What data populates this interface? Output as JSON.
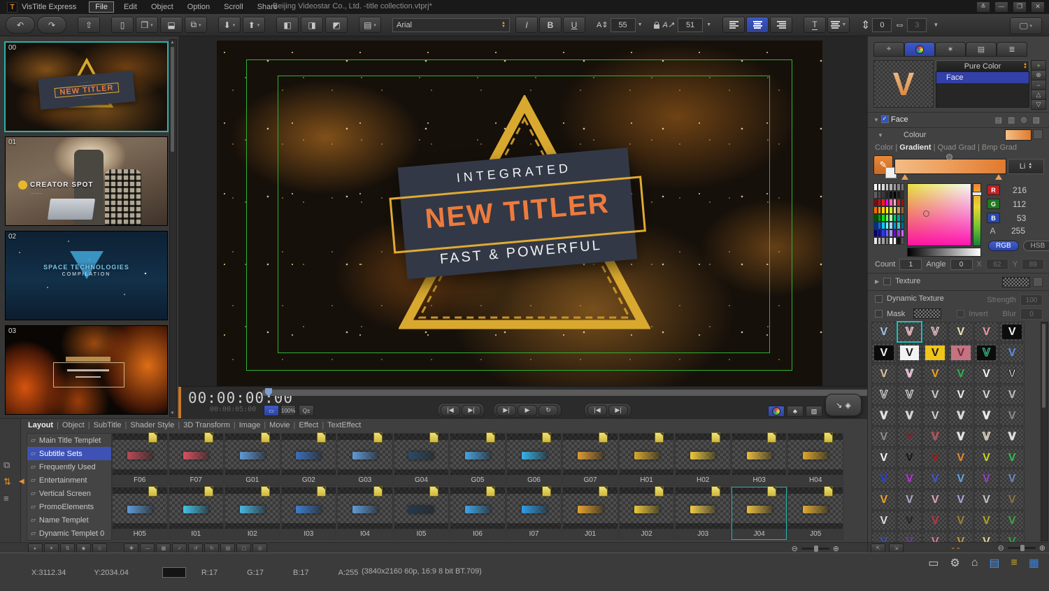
{
  "window": {
    "app_name": "VisTitle Express",
    "logo_letter": "T",
    "menus": [
      "File",
      "Edit",
      "Object",
      "Option",
      "Scroll",
      "Share"
    ],
    "active_menu": "File",
    "title": "Beijing Videostar Co., Ltd. -title collection.vtprj*",
    "window_controls": [
      {
        "name": "collapse-icon",
        "g": "≚"
      },
      {
        "name": "minimize-icon",
        "g": "—"
      },
      {
        "name": "restore-icon",
        "g": "❐"
      },
      {
        "name": "close-icon",
        "g": "✕"
      }
    ]
  },
  "toolbar": {
    "font_family": "Arial",
    "font_size": "55",
    "kerning": "51",
    "line_spacing": "0",
    "char_spacing": "3",
    "italic": "I",
    "bold": "B",
    "underline": "U",
    "groups": [
      {
        "cls": "pill",
        "items": [
          {
            "n": "undo-icon",
            "g": "↶"
          },
          {
            "n": "redo-icon",
            "g": "↷"
          }
        ]
      },
      {
        "items": [
          {
            "n": "publish-icon",
            "g": "⇧"
          }
        ]
      },
      {
        "items": [
          {
            "n": "new-document-icon",
            "g": "▯"
          },
          {
            "n": "open-project-icon",
            "g": "❒",
            "dd": true
          },
          {
            "n": "save-icon",
            "g": "⬓"
          },
          {
            "n": "save-all-icon",
            "g": "⧉",
            "dd": true
          }
        ]
      },
      {
        "items": [
          {
            "n": "import-icon",
            "g": "⬇",
            "dd": true
          },
          {
            "n": "export-icon",
            "g": "⬆",
            "dd": true
          }
        ]
      },
      {
        "items": [
          {
            "n": "clapper-new-icon",
            "g": "◧"
          },
          {
            "n": "clapper-open-icon",
            "g": "◨"
          },
          {
            "n": "clapper-save-icon",
            "g": "◩"
          }
        ]
      },
      {
        "items": [
          {
            "n": "script-edit-icon",
            "g": "▤",
            "dd": true
          }
        ]
      }
    ]
  },
  "slides": {
    "items": [
      {
        "id": "00",
        "variant": "titler",
        "selected": true
      },
      {
        "id": "01",
        "variant": "creator",
        "selected": false
      },
      {
        "id": "02",
        "variant": "space",
        "selected": false
      },
      {
        "id": "03",
        "variant": "fire",
        "selected": false
      }
    ],
    "titler_line2": "NEW TITLER",
    "creator_label": "CREATOR SPOT",
    "space_line1": "SPACE TECHNOLOGIES",
    "space_line2": "COMPILATION"
  },
  "preview": {
    "line1": "INTEGRATED",
    "line2": "NEW TITLER",
    "line3": "FAST & POWERFUL",
    "safe_color": "#2db32d",
    "triangle_color": "#d9a92f",
    "banner_color": "#323846",
    "accent_text": "#ed7b3d"
  },
  "timeline": {
    "timecode": "00:00:00:00",
    "duration": "00:00:05:00",
    "zoom_level": "100%",
    "monitor_icon": "▭",
    "magnify_icon": "Q±",
    "transport": [
      {
        "grp": [
          {
            "n": "jump-start-button",
            "g": "|◀"
          },
          {
            "n": "jump-end-button",
            "g": "▶|"
          }
        ]
      },
      {
        "grp": [
          {
            "n": "play-from-start-button",
            "g": "▶|"
          },
          {
            "n": "play-button",
            "g": "▶"
          },
          {
            "n": "loop-button",
            "g": "↻"
          }
        ]
      },
      {
        "grp": [
          {
            "n": "prev-frame-button",
            "g": "|◀"
          },
          {
            "n": "next-frame-button",
            "g": "▶|"
          }
        ]
      }
    ],
    "right_buttons": [
      {
        "n": "color-mode-button",
        "kind": "wheel",
        "active": true
      },
      {
        "n": "clover-button",
        "g": "♣"
      },
      {
        "n": "image-mode-button",
        "g": "▨"
      }
    ],
    "pill_icons": [
      {
        "n": "transform-icon",
        "g": "↘"
      },
      {
        "n": "keyframe-icon",
        "g": "◈"
      }
    ]
  },
  "right_panel": {
    "tabs": [
      {
        "n": "select-tool-tab",
        "g": "⌖",
        "active": false
      },
      {
        "n": "color-style-tab",
        "g": "wheel",
        "active": true
      },
      {
        "n": "effect-wand-tab",
        "g": "✶",
        "active": false
      },
      {
        "n": "template-doc-tab",
        "g": "▤",
        "active": false
      },
      {
        "n": "layer-list-tab",
        "g": "≣",
        "active": false
      }
    ],
    "side_buttons": [
      {
        "n": "add-style-button",
        "g": "+",
        "c": "#84c96c"
      },
      {
        "n": "add-multi-button",
        "g": "⊕",
        "c": "#bbb"
      },
      {
        "n": "remove-style-button",
        "g": "−",
        "c": "#bbb"
      },
      {
        "n": "move-up-button",
        "g": "△",
        "c": "#bbb"
      },
      {
        "n": "move-down-button",
        "g": "▽",
        "c": "#bbb"
      }
    ],
    "preview_letter": "V",
    "style_mode": "Pure Color",
    "layer_item": "Face",
    "face_label": "Face",
    "face_icons": [
      "▤",
      "▥",
      "⊜",
      "▧"
    ],
    "colour_label": "Colour",
    "grad_tabs": [
      "Color",
      "Gradient",
      "Quad Grad",
      "Bmp Grad"
    ],
    "active_grad_tab": "Gradient",
    "li_label": "Li",
    "eyedropper_icon": "✎",
    "rgb": {
      "r_label": "R",
      "r": "216",
      "g_label": "G",
      "g": "112",
      "b_label": "B",
      "b": "53",
      "a_label": "A",
      "a": "255"
    },
    "mode_rgb": "RGB",
    "mode_hsb": "HSB",
    "count_label": "Count",
    "count": "1",
    "angle_label": "Angle",
    "angle": "0",
    "x_label": "X",
    "x": "62",
    "y_label": "Y",
    "y": "89",
    "texture_label": "Texture",
    "dynamic_texture_label": "Dynamic Texture",
    "strength_label": "Strength",
    "strength": "100",
    "mask_label": "Mask",
    "invert_label": "Invert",
    "blur_label": "Blur",
    "blur": "0",
    "palette": [
      "#ffffff",
      "#ececec",
      "#d8d8d8",
      "#c4c4c4",
      "#b0b0b0",
      "#9c9c9c",
      "#888888",
      "#747474",
      "#606060",
      "#4c4c4c",
      "#383838",
      "#242424",
      "#101010",
      "#000000",
      "#1c1c1c",
      "#303030",
      "#7a0c0c",
      "#c01010",
      "#ff1a1a",
      "#ff00ff",
      "#ff66b0",
      "#ffb6c1",
      "#d02020",
      "#901414",
      "#ff6600",
      "#ff9900",
      "#ffcc00",
      "#ffff00",
      "#ccee22",
      "#ffd699",
      "#cc9955",
      "#996633",
      "#005500",
      "#00a000",
      "#00ee00",
      "#66ff66",
      "#aaffaa",
      "#00cc66",
      "#00a0a0",
      "#006666",
      "#003090",
      "#0066ff",
      "#00ccff",
      "#66ffff",
      "#a8d4ff",
      "#0099cc",
      "#33cccc",
      "#006699",
      "#000066",
      "#0000cc",
      "#3333ff",
      "#6666ff",
      "#9999ff",
      "#7700cc",
      "#9933ff",
      "#cc66ff",
      "#e8e8e8",
      "#c0c0c0",
      "#a0a0a0",
      "#808080",
      "#f0f0f0",
      "#ffffff",
      "#111111",
      "#555555"
    ]
  },
  "presets": {
    "letter": "V",
    "selected_index": 1,
    "items": [
      {
        "c": "#9ec3e2"
      },
      {
        "c": "#d6404e",
        "o": "#f2f2f2"
      },
      {
        "c": "#8c2633",
        "o": "#f2f2f2"
      },
      {
        "c": "#ece6b4"
      },
      {
        "c": "#eb9aa2"
      },
      {
        "c": "#f5f5f5",
        "bg": "#0d0d0d"
      },
      {
        "c": "#f5f5f5",
        "bg": "#0a0a0a"
      },
      {
        "c": "#141414",
        "bg": "#f2f2f2"
      },
      {
        "c": "#1a1a1a",
        "bg": "#f0c419"
      },
      {
        "c": "#71293a",
        "bg": "#c47480"
      },
      {
        "c": "#101010",
        "o": "#3ddc97",
        "bg": "#0c0c0c"
      },
      {
        "c": "#5b8fe8"
      },
      {
        "c": "#dcc3a1"
      },
      {
        "c": "#e26ca8",
        "o": "#f5f5f5"
      },
      {
        "c": "#f0a21e"
      },
      {
        "c": "#2eb34a"
      },
      {
        "c": "#f2f2f2"
      },
      {
        "c": "#fdfdfd",
        "o": "#1a1a1a"
      },
      {
        "c": "#161616",
        "o": "#f5f5f5"
      },
      {
        "c": "#101010",
        "o": "#ffffff"
      },
      {
        "c": "#c9c9c9"
      },
      {
        "c": "#ededed"
      },
      {
        "c": "#d4d4d4"
      },
      {
        "c": "#bdbdbd"
      },
      {
        "c": "transparent",
        "o": "#e8e8e8"
      },
      {
        "c": "transparent",
        "o": "#dddddd"
      },
      {
        "c": "#cfcfcf"
      },
      {
        "c": "transparent",
        "o": "#e0e0e0"
      },
      {
        "c": "transparent",
        "o": "#f0f0f0"
      },
      {
        "c": "#8a8a8a"
      },
      {
        "c": "#8f8f8f"
      },
      {
        "c": "#7e2230"
      },
      {
        "c": "#3a6fd8",
        "o": "#d84a2e"
      },
      {
        "c": "transparent",
        "o": "#ececec"
      },
      {
        "c": "#a5834a",
        "o": "#f0f0f0"
      },
      {
        "c": "transparent",
        "o": "#e6e6e6"
      },
      {
        "c": "#f5f5f5"
      },
      {
        "c": "#161616"
      },
      {
        "c": "#9e1b1b"
      },
      {
        "c": "#e8892b"
      },
      {
        "c": "#cdd41c"
      },
      {
        "c": "#2ec04e"
      },
      {
        "c": "#2440dd"
      },
      {
        "c": "#bd2ee0"
      },
      {
        "c": "#3f54d6"
      },
      {
        "c": "#5ea6ec"
      },
      {
        "c": "#9340c4"
      },
      {
        "c": "#6a86c8"
      },
      {
        "c": "#eda224"
      },
      {
        "c": "#b3a6cc"
      },
      {
        "c": "#dca6b4"
      },
      {
        "c": "#b1a2dc"
      },
      {
        "c": "#c3c3cd"
      },
      {
        "c": "#8d7140"
      },
      {
        "c": "#dcdce4"
      },
      {
        "c": "#242424"
      },
      {
        "c": "#c23243"
      },
      {
        "c": "#9c8030"
      },
      {
        "c": "#b2a41e"
      },
      {
        "c": "#3da445"
      },
      {
        "c": "#3353c6"
      },
      {
        "c": "#8430b4"
      },
      {
        "c": "#e274a6"
      },
      {
        "c": "#cf9340"
      },
      {
        "c": "#e2d494"
      },
      {
        "c": "#31a437"
      }
    ]
  },
  "bottom": {
    "tabs": [
      "Layout",
      "Object",
      "SubTitle",
      "Shader Style",
      "3D Transform",
      "Image",
      "Movie",
      "Effect",
      "TextEffect"
    ],
    "active_tab": "Layout",
    "categories": [
      "Main Title Templet",
      "Subtitle Sets",
      "Frequently Used",
      "Entertainment",
      "Vertical Screen",
      "PromoElements",
      "Name Templet",
      "Dynamic Templet 0"
    ],
    "selected_category": "Subtitle Sets",
    "row1": [
      {
        "label": "F06",
        "color": "#b84a56"
      },
      {
        "label": "F07",
        "color": "#d85060"
      },
      {
        "label": "G01",
        "color": "#5f9bd8"
      },
      {
        "label": "G02",
        "color": "#3d6fb8"
      },
      {
        "label": "G03",
        "color": "#5f9bd8"
      },
      {
        "label": "G04",
        "color": "#2c4a66"
      },
      {
        "label": "G05",
        "color": "#49a2e0"
      },
      {
        "label": "G06",
        "color": "#37b2e8"
      },
      {
        "label": "G07",
        "color": "#e09a34"
      },
      {
        "label": "H01",
        "color": "#d8a830"
      },
      {
        "label": "H02",
        "color": "#ecc83e"
      },
      {
        "label": "H03",
        "color": "#e8bc40"
      },
      {
        "label": "H04",
        "color": "#dca62c"
      }
    ],
    "row2": [
      {
        "label": "H05",
        "color": "#5f9bd8"
      },
      {
        "label": "I01",
        "color": "#45c2e8"
      },
      {
        "label": "I02",
        "color": "#49b6e0"
      },
      {
        "label": "I03",
        "color": "#3d7fd0"
      },
      {
        "label": "I04",
        "color": "#5f9bd8"
      },
      {
        "label": "I05",
        "color": "#24384c"
      },
      {
        "label": "I06",
        "color": "#41a6e8"
      },
      {
        "label": "I07",
        "color": "#2e9ee8"
      },
      {
        "label": "J01",
        "color": "#e8a42c"
      },
      {
        "label": "J02",
        "color": "#ecc838"
      },
      {
        "label": "J03",
        "color": "#f0cc48"
      },
      {
        "label": "J04",
        "color": "#e8c040"
      },
      {
        "label": "J05",
        "color": "#e0aa30"
      }
    ],
    "selected_template": "J04",
    "strip_icons": [
      {
        "n": "hierarchy-icon",
        "g": "⧉",
        "c": "#a0a0a0"
      },
      {
        "n": "reorder-icon",
        "g": "⇅",
        "c": "#e8922e"
      },
      {
        "n": "layers-icon",
        "g": "≡",
        "c": "#a0a0a0"
      }
    ],
    "footer_left": [
      "▸",
      "▾",
      "⇅",
      "◆",
      "◇"
    ],
    "footer_mid": [
      "✚",
      "—",
      "▦",
      "✓",
      "↺",
      "↻",
      "▤",
      "▢",
      "◎"
    ]
  },
  "status": {
    "x": "X:3112.34",
    "y": "Y:2034.04",
    "r": "R:17",
    "g": "G:17",
    "b": "B:17",
    "a": "A:255",
    "format": "(3840x2160 60p, 16:9 8 bit BT.709)",
    "icons": [
      {
        "n": "presentation-display-icon",
        "g": "▭",
        "c": "#c8c8c8"
      },
      {
        "n": "wrench-icon",
        "g": "⚙",
        "c": "#c8c8c8"
      },
      {
        "n": "home-icon",
        "g": "⌂",
        "c": "#c8c8c8"
      },
      {
        "n": "clip-list-icon",
        "g": "▤",
        "c": "#4a90e8"
      },
      {
        "n": "sliders-icon",
        "g": "≡",
        "c": "#d4b02a"
      },
      {
        "n": "drive-icon",
        "g": "▦",
        "c": "#3a80d8"
      }
    ]
  }
}
